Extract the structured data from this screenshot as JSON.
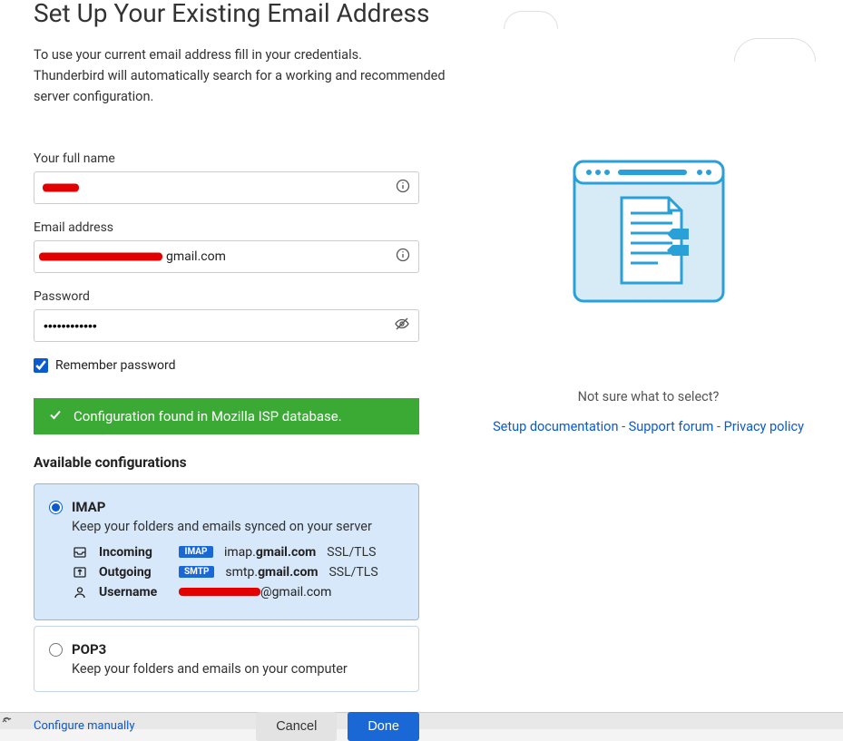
{
  "header": {
    "title": "Set Up Your Existing Email Address",
    "description_line1": "To use your current email address fill in your credentials.",
    "description_line2": "Thunderbird will automatically search for a working and recommended server configuration."
  },
  "form": {
    "full_name_label": "Your full name",
    "full_name_value": "[redacted]",
    "email_label": "Email address",
    "email_visible_suffix": "gmail.com",
    "email_value": "[redacted]@gmail.com",
    "password_label": "Password",
    "password_value": "••••••••••••",
    "remember_label": "Remember password",
    "remember_checked": true
  },
  "status": {
    "message": "Configuration found in Mozilla ISP database."
  },
  "configs": {
    "title": "Available configurations",
    "imap": {
      "title": "IMAP",
      "desc": "Keep your folders and emails synced on your server",
      "incoming_label": "Incoming",
      "incoming_badge": "IMAP",
      "incoming_server_pre": "imap.",
      "incoming_server_bold": "gmail.com",
      "incoming_sec": "SSL/TLS",
      "outgoing_label": "Outgoing",
      "outgoing_badge": "SMTP",
      "outgoing_server_pre": "smtp.",
      "outgoing_server_bold": "gmail.com",
      "outgoing_sec": "SSL/TLS",
      "username_label": "Username",
      "username_suffix": "@gmail.com"
    },
    "pop3": {
      "title": "POP3",
      "desc": "Keep your folders and emails on your computer"
    }
  },
  "actions": {
    "configure_manually": "Configure manually",
    "cancel": "Cancel",
    "done": "Done"
  },
  "help": {
    "prompt": "Not sure what to select?",
    "setup_doc": "Setup documentation",
    "support": "Support forum",
    "privacy": "Privacy policy",
    "separator": " - "
  }
}
